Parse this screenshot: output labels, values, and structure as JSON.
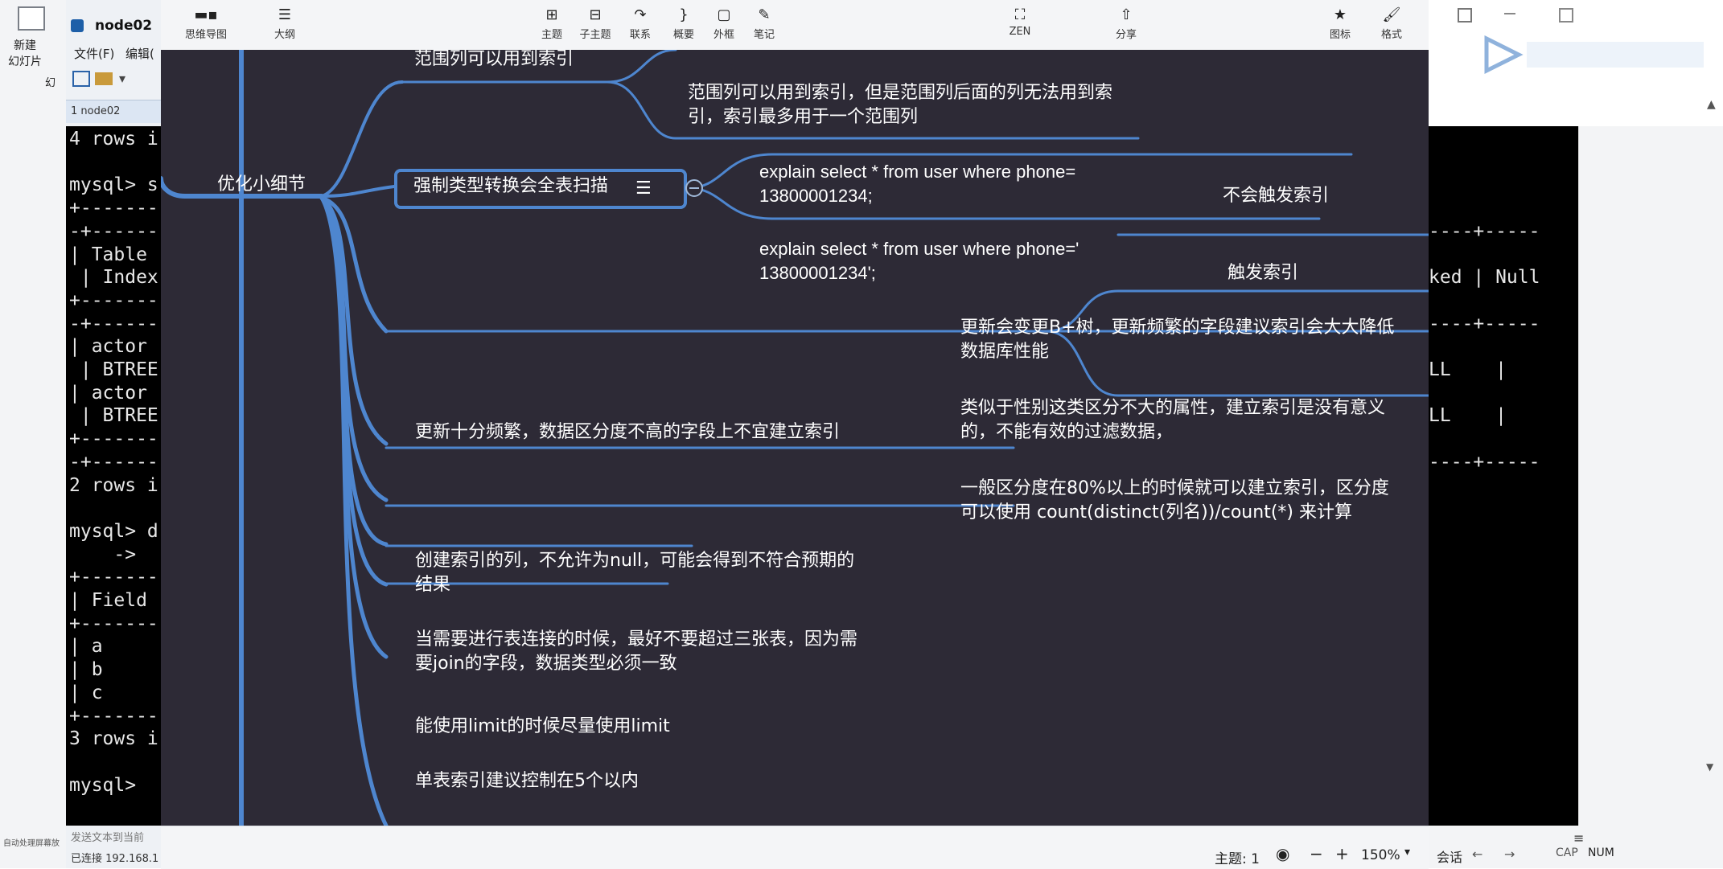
{
  "ppt": {
    "new_slide_line1": "新建",
    "new_slide_line2": "幻灯片",
    "slide_label": "幻",
    "send_text": "发送文本到当前",
    "status_small": "自动处理屏幕放"
  },
  "xshell": {
    "title": "node02",
    "menu_file": "文件(F)",
    "menu_edit": "编辑(",
    "tab_label": "1 node02",
    "status_text": "已连接 192.168.1",
    "terminal_lines": [
      "4 rows i",
      "",
      "mysql> s",
      "+-------",
      "-+------",
      "| Table",
      " | Index",
      "+-------",
      "-+------",
      "| actor",
      " | BTREE",
      "| actor",
      " | BTREE",
      "+-------",
      "-+------",
      "2 rows i",
      "",
      "mysql> d",
      "    ->",
      "+-------",
      "| Field",
      "+-------",
      "| a",
      "| b",
      "| c",
      "+-------",
      "3 rows i",
      "",
      "mysql> "
    ],
    "right_terminal_lines": [
      "",
      "",
      "",
      "",
      "----+-----",
      "",
      "ked | Null",
      "",
      "----+-----",
      "",
      "LL    |",
      "",
      "LL    |",
      "",
      "----+-----"
    ],
    "right_status_word": "会话",
    "caps": "CAP",
    "num": "NUM"
  },
  "toolbar": {
    "mindmap_tab": "思维导图",
    "outline_tab": "大纲",
    "topic": "主题",
    "subtopic": "子主题",
    "relation": "联系",
    "summary": "概要",
    "boundary": "外框",
    "note": "笔记",
    "zen": "ZEN",
    "share": "分享",
    "icon": "图标",
    "format": "格式"
  },
  "mindmap": {
    "root": "优化小细节",
    "b1": "范围列可以用到索引",
    "b1_note_l1": "范围列可以用到索引，但是范围列后面的列无法用到索",
    "b1_note_l2": "引，索引最多用于一个范围列",
    "b2": "强制类型转换会全表扫描",
    "b2_c1_l1": "explain select * from user where phone=",
    "b2_c1_l2": "13800001234;",
    "b2_c1_tag": "不会触发索引",
    "b2_c2_l1": "explain select * from user where phone='",
    "b2_c2_l2": "13800001234';",
    "b2_c2_tag": "触发索引",
    "b3": "更新十分频繁，数据区分度不高的字段上不宜建立索引",
    "b3_c1_l1": "更新会变更B+树，更新频繁的字段建议索引会大大降低",
    "b3_c1_l2": "数据库性能",
    "b3_c2_l1": "类似于性别这类区分不大的属性，建立索引是没有意义",
    "b3_c2_l2": "的，不能有效的过滤数据，",
    "b3_c3_l1": "一般区分度在80%以上的时候就可以建立索引，区分度",
    "b3_c3_l2": "可以使用 count(distinct(列名))/count(*) 来计算",
    "b4_l1": "创建索引的列，不允许为null，可能会得到不符合预期的",
    "b4_l2": "结果",
    "b5_l1": "当需要进行表连接的时候，最好不要超过三张表，因为需",
    "b5_l2": "要join的字段，数据类型必须一致",
    "b6": "能使用limit的时候尽量使用limit",
    "b7": "单表索引建议控制在5个以内"
  },
  "footer": {
    "topic_count": "主题: 1",
    "zoom": "150%"
  },
  "colors": {
    "canvas": "#2d2a36",
    "branch": "#4e86cf",
    "terminal": "#000000"
  }
}
